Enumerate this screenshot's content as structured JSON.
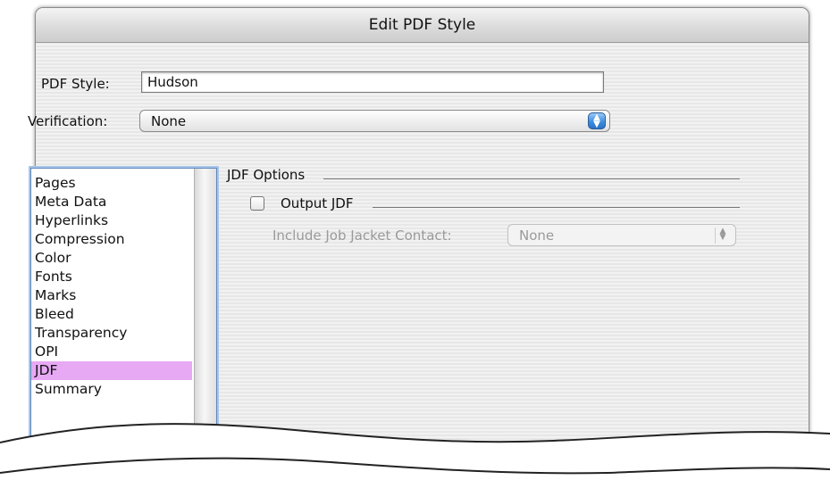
{
  "window": {
    "title": "Edit PDF Style"
  },
  "form": {
    "pdf_style_label": "PDF Style:",
    "pdf_style_value": "Hudson",
    "verification_label": "Verification:",
    "verification_value": "None"
  },
  "sidebar": {
    "items": [
      {
        "label": "Pages"
      },
      {
        "label": "Meta Data"
      },
      {
        "label": "Hyperlinks"
      },
      {
        "label": "Compression"
      },
      {
        "label": "Color"
      },
      {
        "label": "Fonts"
      },
      {
        "label": "Marks"
      },
      {
        "label": "Bleed"
      },
      {
        "label": "Transparency"
      },
      {
        "label": "OPI"
      },
      {
        "label": "JDF"
      },
      {
        "label": "Summary"
      }
    ],
    "selected": "JDF",
    "selected_color": "#e7a9f4"
  },
  "jdf": {
    "section_title": "JDF Options",
    "output_jdf_label": "Output JDF",
    "output_jdf_checked": false,
    "job_jacket_label": "Include Job Jacket Contact:",
    "job_jacket_value": "None"
  }
}
